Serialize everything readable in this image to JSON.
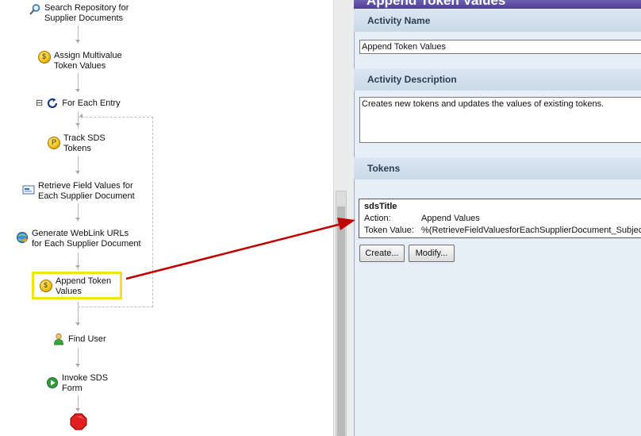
{
  "workflow": {
    "steps": [
      {
        "label": "Search Repository for\nSupplier Documents",
        "icon": "search-icon"
      },
      {
        "label": "Assign Multivalue\nToken Values",
        "icon": "token-coin-icon"
      },
      {
        "label": "For Each Entry",
        "icon": "loop-icon"
      },
      {
        "label": "Track SDS\nTokens",
        "icon": "token-track-icon"
      },
      {
        "label": "Retrieve Field Values for\nEach Supplier Document",
        "icon": "field-values-icon"
      },
      {
        "label": "Generate WebLink URLs\nfor Each Supplier Document",
        "icon": "weblink-icon"
      },
      {
        "label": "Append Token\nValues",
        "icon": "token-coin-icon"
      },
      {
        "label": "Find User",
        "icon": "user-icon"
      },
      {
        "label": "Invoke SDS\nForm",
        "icon": "invoke-form-icon"
      }
    ],
    "collapse_glyph": "⊟",
    "end_icon": "stop-icon"
  },
  "panel": {
    "title": "Append Token Values",
    "activity_name": {
      "header": "Activity Name",
      "value": "Append Token Values"
    },
    "activity_description": {
      "header": "Activity Description",
      "value": "Creates new tokens and updates the values of existing tokens."
    },
    "tokens": {
      "header": "Tokens",
      "items": [
        {
          "name": "sdsTitle",
          "action_label": "Action:",
          "action_value": "Append Values",
          "value_label": "Token Value:",
          "value": "%(RetrieveFieldValuesforEachSupplierDocument_Subject)"
        }
      ],
      "create_label": "Create...",
      "modify_label": "Modify..."
    }
  },
  "colors": {
    "highlight": "#f2e21a",
    "arrow": "#c00000",
    "panel_bg": "#e6eef7"
  }
}
